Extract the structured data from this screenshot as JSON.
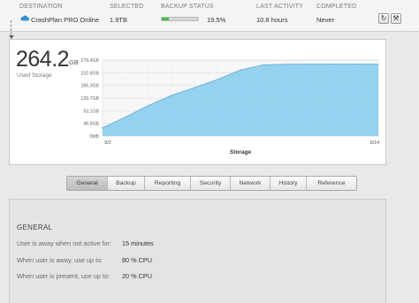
{
  "header": {
    "columns": {
      "destination": "DESTINATION",
      "selected": "SELECTED",
      "backup_status": "BACKUP STATUS",
      "last_activity": "LAST ACTIVITY",
      "completed": "COMPLETED"
    },
    "row": {
      "destination": "CrashPlan PRO Online",
      "selected": "1.9TB",
      "backup_percent_label": "19.5%",
      "backup_progress": 0.195,
      "last_activity": "10.8 hours",
      "completed": "Never"
    },
    "icons": {
      "destination": "cloud-icon",
      "refresh": "refresh-icon",
      "settings": "wrench-icon"
    }
  },
  "storage": {
    "used_value": "264.2",
    "used_unit": "GB",
    "used_label": "Used Storage"
  },
  "chart_data": {
    "type": "area",
    "xlabel": "Storage",
    "x_tick_labels": [
      "9/2",
      "9/14"
    ],
    "y_ticks": [
      "0MB",
      "46.6GB",
      "93.1GB",
      "139.7GB",
      "186.3GB",
      "232.8GB",
      "279.4GB"
    ],
    "ylim": [
      0,
      279.4
    ],
    "y_unit": "GB",
    "x": [
      0,
      1,
      2,
      3,
      4,
      5,
      6,
      7,
      8,
      9,
      10,
      11,
      12
    ],
    "values": [
      30,
      70,
      112,
      150,
      178,
      208,
      243,
      262,
      264,
      264.2,
      264.2,
      264.2,
      264.2
    ],
    "color": "#8fd0ee",
    "line_color": "#5aa9d6",
    "grid": true
  },
  "tabs": [
    {
      "label": "General",
      "active": true
    },
    {
      "label": "Backup",
      "active": false
    },
    {
      "label": "Reporting",
      "active": false
    },
    {
      "label": "Security",
      "active": false
    },
    {
      "label": "Network",
      "active": false
    },
    {
      "label": "History",
      "active": false
    },
    {
      "label": "Reference",
      "active": false
    }
  ],
  "general": {
    "title": "GENERAL",
    "rows": [
      {
        "label": "User is away when not active for:",
        "value": "15 minutes"
      },
      {
        "label": "When user is away, use up to:",
        "value": "80 % CPU"
      },
      {
        "label": "When user is present, use up to:",
        "value": "20 % CPU"
      }
    ]
  }
}
